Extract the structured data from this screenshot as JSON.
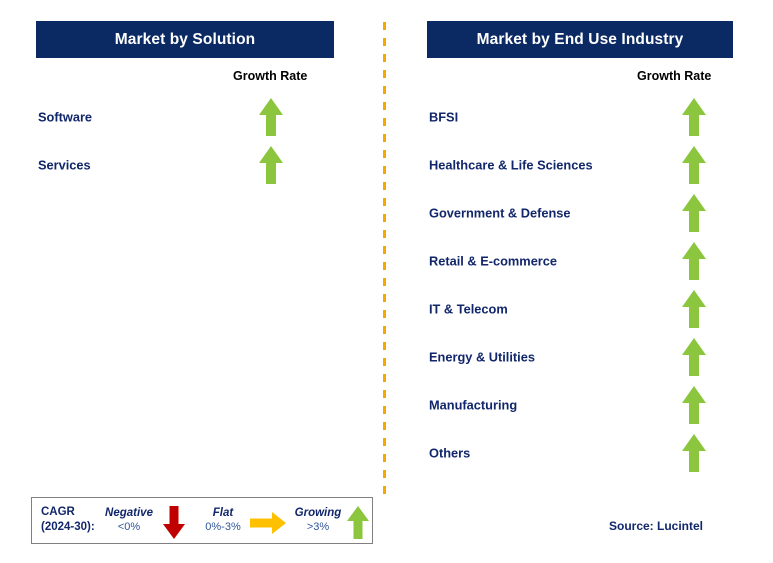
{
  "colors": {
    "header_navy": "#0B2A63",
    "label_navy": "#12276B",
    "arrow_green": "#8CC63E",
    "arrow_red": "#C00000",
    "arrow_yellow": "#FFC000",
    "divider_orange": "#F5A800",
    "legend_border": "#808080",
    "legend_value": "#2F5597"
  },
  "left_panel": {
    "title": "Market by Solution",
    "growth_rate_header": "Growth Rate",
    "rows": [
      {
        "label": "Software",
        "growth": "growing",
        "icon": "arrow-up-icon"
      },
      {
        "label": "Services",
        "growth": "growing",
        "icon": "arrow-up-icon"
      }
    ]
  },
  "right_panel": {
    "title": "Market by End Use Industry",
    "growth_rate_header": "Growth Rate",
    "rows": [
      {
        "label": "BFSI",
        "growth": "growing",
        "icon": "arrow-up-icon"
      },
      {
        "label": "Healthcare & Life Sciences",
        "growth": "growing",
        "icon": "arrow-up-icon"
      },
      {
        "label": "Government & Defense",
        "growth": "growing",
        "icon": "arrow-up-icon"
      },
      {
        "label": "Retail & E-commerce",
        "growth": "growing",
        "icon": "arrow-up-icon"
      },
      {
        "label": "IT & Telecom",
        "growth": "growing",
        "icon": "arrow-up-icon"
      },
      {
        "label": "Energy & Utilities",
        "growth": "growing",
        "icon": "arrow-up-icon"
      },
      {
        "label": "Manufacturing",
        "growth": "growing",
        "icon": "arrow-up-icon"
      },
      {
        "label": "Others",
        "growth": "growing",
        "icon": "arrow-up-icon"
      }
    ]
  },
  "legend": {
    "cagr_line1": "CAGR",
    "cagr_line2": "(2024-30):",
    "entries": [
      {
        "title": "Negative",
        "value": "<0%",
        "icon": "arrow-down-icon"
      },
      {
        "title": "Flat",
        "value": "0%-3%",
        "icon": "arrow-right-icon"
      },
      {
        "title": "Growing",
        "value": ">3%",
        "icon": "arrow-up-icon"
      }
    ]
  },
  "source": "Source: Lucintel",
  "chart_data": {
    "type": "table",
    "title": "Market Growth Rate by Segment",
    "categories_left": [
      "Software",
      "Services"
    ],
    "categories_right": [
      "BFSI",
      "Healthcare & Life Sciences",
      "Government & Defense",
      "Retail & E-commerce",
      "IT & Telecom",
      "Energy & Utilities",
      "Manufacturing",
      "Others"
    ],
    "values_left": [
      "growing",
      "growing"
    ],
    "values_right": [
      "growing",
      "growing",
      "growing",
      "growing",
      "growing",
      "growing",
      "growing",
      "growing"
    ],
    "legend_scale": [
      {
        "name": "Negative",
        "range": "<0%"
      },
      {
        "name": "Flat",
        "range": "0%-3%"
      },
      {
        "name": "Growing",
        "range": ">3%"
      }
    ]
  }
}
